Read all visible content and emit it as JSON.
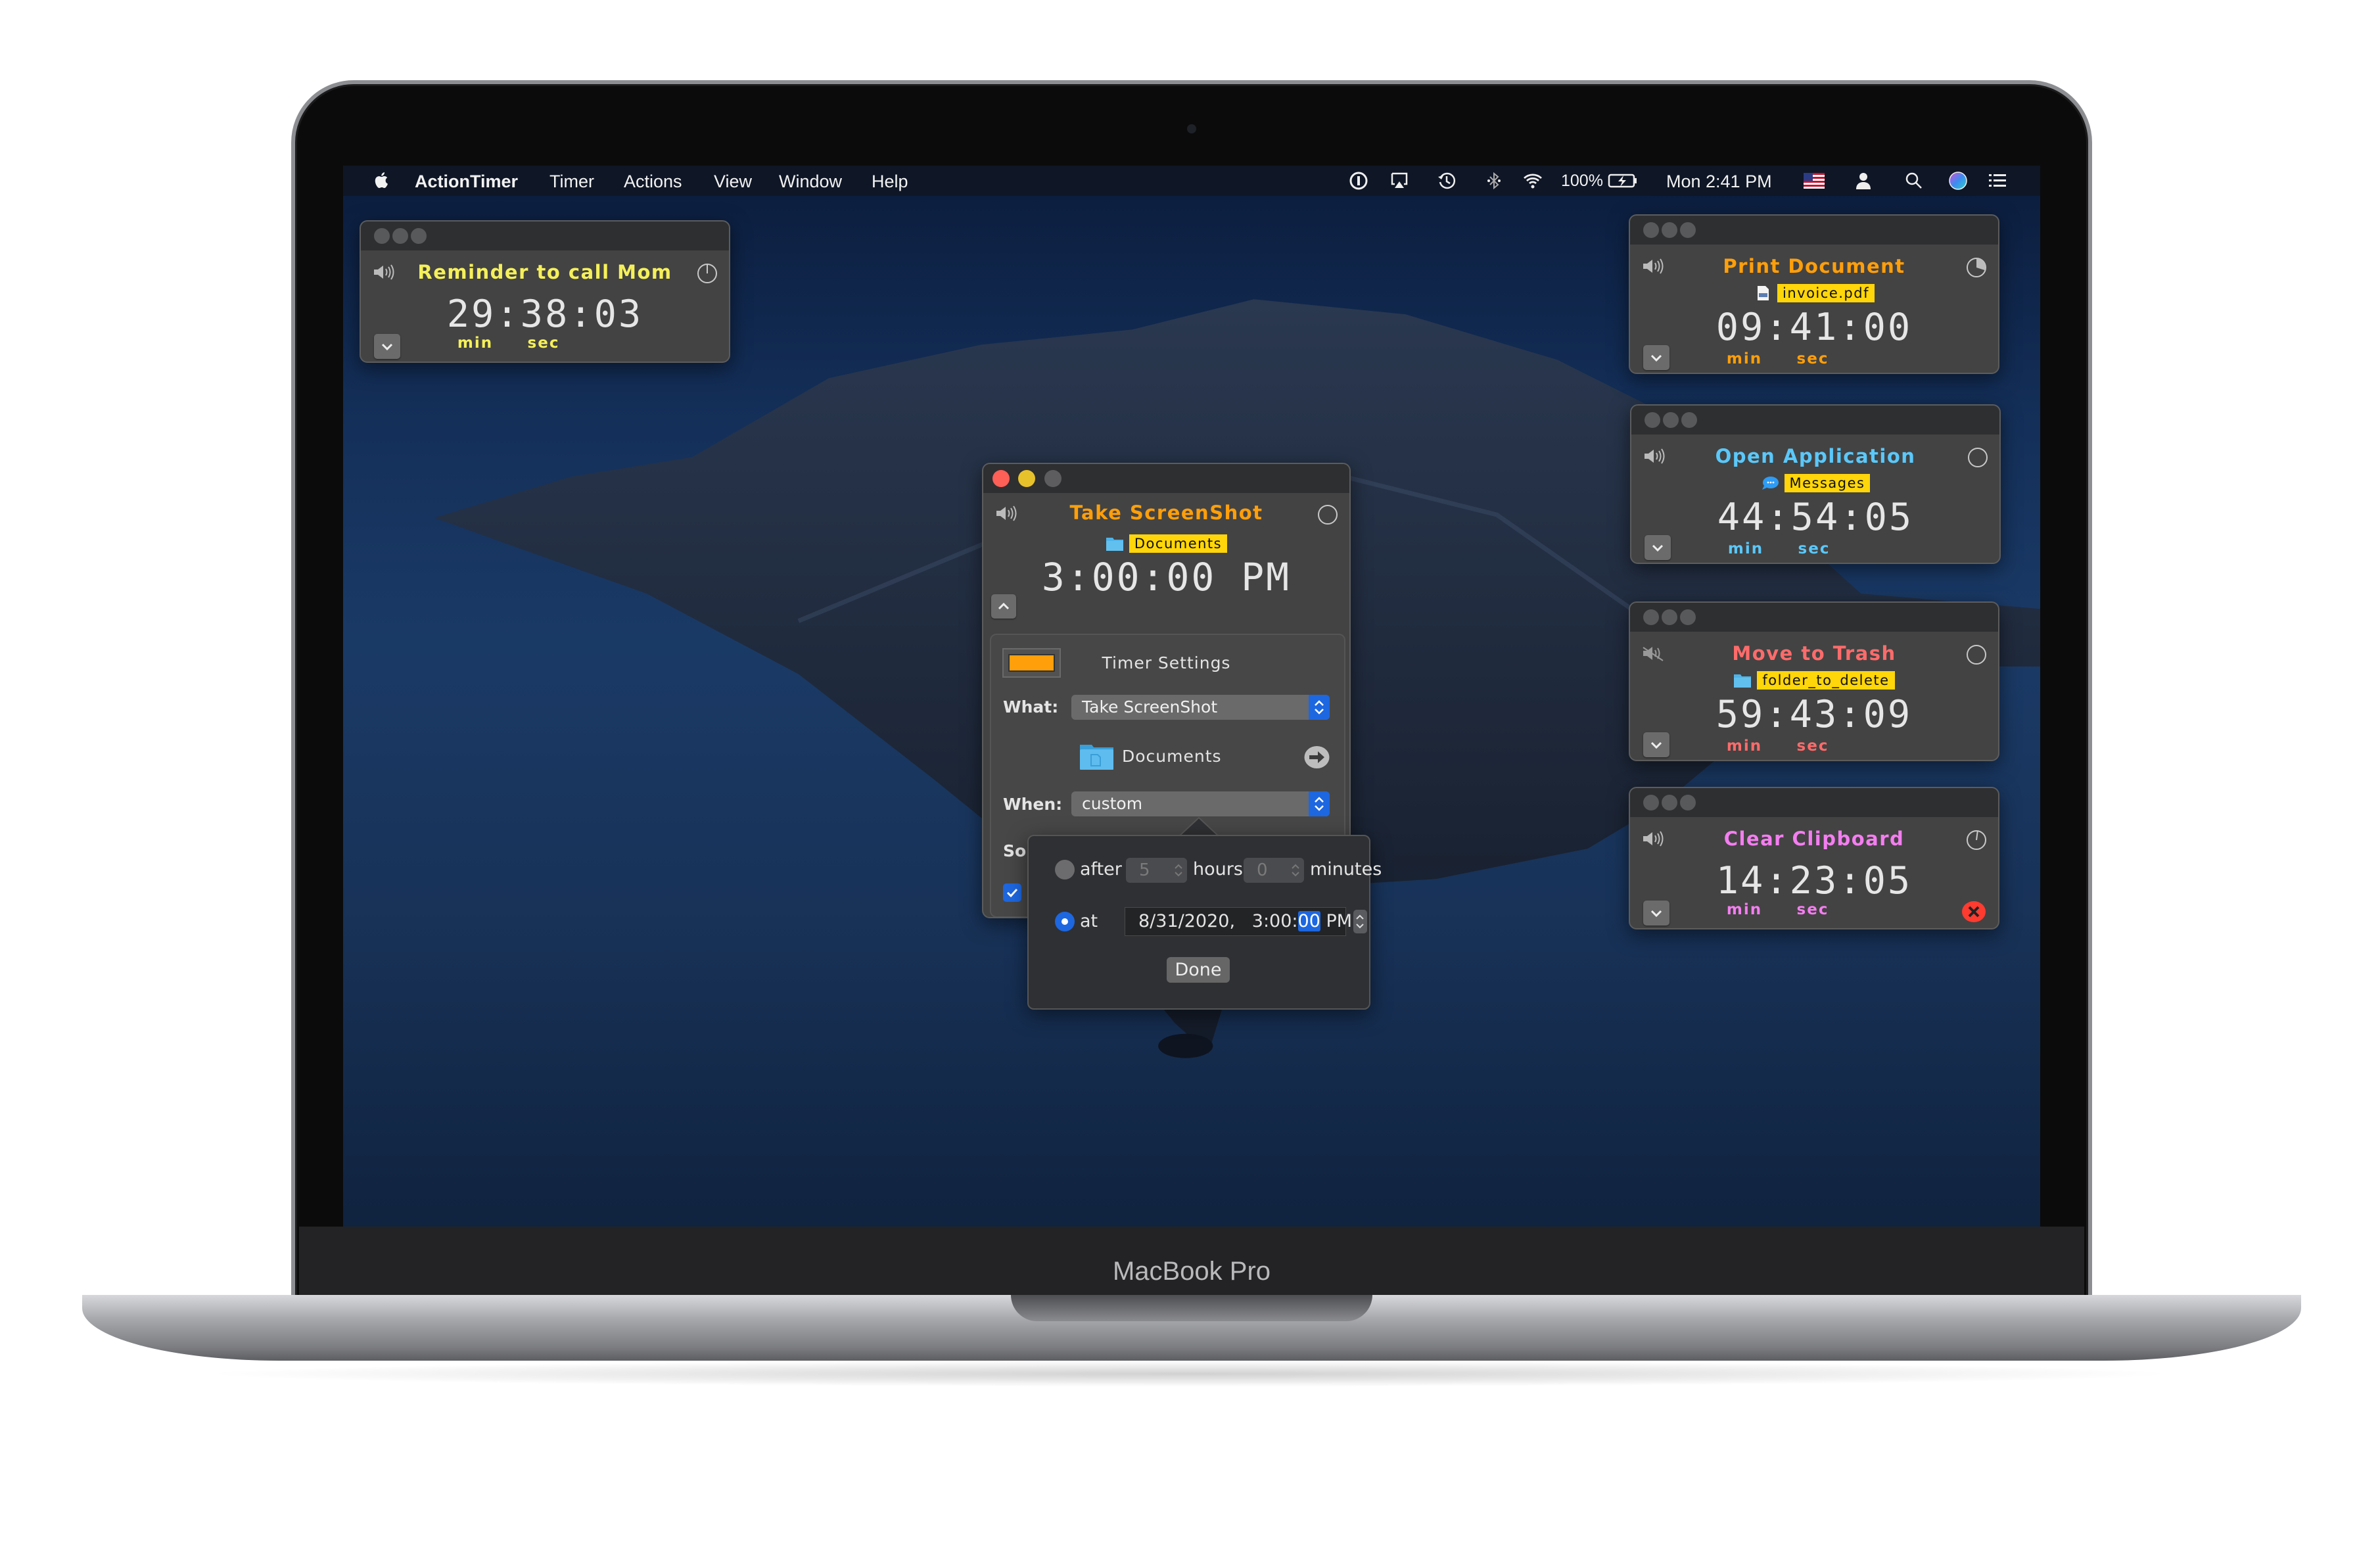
{
  "device": {
    "brand": "MacBook Pro"
  },
  "menubar": {
    "app_name": "ActionTimer",
    "items": [
      "Timer",
      "Actions",
      "View",
      "Window",
      "Help"
    ],
    "battery": "100%",
    "clock": "Mon 2:41 PM",
    "status_icons": [
      "1password-icon",
      "airplay-icon",
      "time-machine-icon",
      "bluetooth-icon",
      "wifi-icon",
      "battery-charging-icon",
      "us-flag-icon",
      "user-icon",
      "spotlight-search-icon",
      "siri-icon",
      "notification-center-icon"
    ]
  },
  "widgets": [
    {
      "title": "Reminder to call Mom",
      "color": "#f5f05a",
      "time": "29:38:03",
      "min_label": "min",
      "sec_label": "sec",
      "badge": null,
      "badge_icon": null,
      "muted": false,
      "progress": 0.0,
      "indicator": "clock-line",
      "show_close": false
    },
    {
      "title": "Print Document",
      "color": "#ff9f0a",
      "time": "09:41:00",
      "min_label": "min",
      "sec_label": "sec",
      "badge": "invoice.pdf",
      "badge_icon": "pdf-file-icon",
      "muted": false,
      "progress": 0.3,
      "indicator": "pie",
      "show_close": false
    },
    {
      "title": "Open Application",
      "color": "#5ac8fa",
      "time": "44:54:05",
      "min_label": "min",
      "sec_label": "sec",
      "badge": "Messages",
      "badge_icon": "messages-app-icon",
      "muted": false,
      "progress": 0.0,
      "indicator": "pie",
      "show_close": false
    },
    {
      "title": "Move to Trash",
      "color": "#ff6b6b",
      "time": "59:43:09",
      "min_label": "min",
      "sec_label": "sec",
      "badge": "folder_to_delete",
      "badge_icon": "folder-icon",
      "muted": true,
      "progress": 0.0,
      "indicator": "pie",
      "show_close": false
    },
    {
      "title": "Clear Clipboard",
      "color": "#f47ef0",
      "time": "14:23:05",
      "min_label": "min",
      "sec_label": "sec",
      "badge": null,
      "badge_icon": null,
      "muted": false,
      "progress": 0.02,
      "indicator": "clock-line",
      "show_close": true
    }
  ],
  "main_window": {
    "title": "Take ScreenShot",
    "title_color": "#ff9f0a",
    "badge": "Documents",
    "time": "3:00:00 PM",
    "settings_title": "Timer Settings",
    "color_well": "#ff9f0a",
    "what_label": "What:",
    "what_value": "Take ScreenShot",
    "folder": "Documents",
    "when_label": "When:",
    "when_value": "custom",
    "sound_label_partial": "Sou",
    "checkbox_checked": true
  },
  "popover": {
    "after_label": "after",
    "hours_value": "5",
    "hours_label": "hours",
    "minutes_value": "0",
    "minutes_label": "minutes",
    "at_label": "at",
    "date_value": "8/31/2020,",
    "time_prefix": "3:00:",
    "time_selected": "00",
    "time_suffix": "PM",
    "selected_option": "at",
    "done_label": "Done"
  },
  "colors": {
    "accent_blue": "#1d67e0",
    "badge_yellow": "#ffd60a"
  }
}
